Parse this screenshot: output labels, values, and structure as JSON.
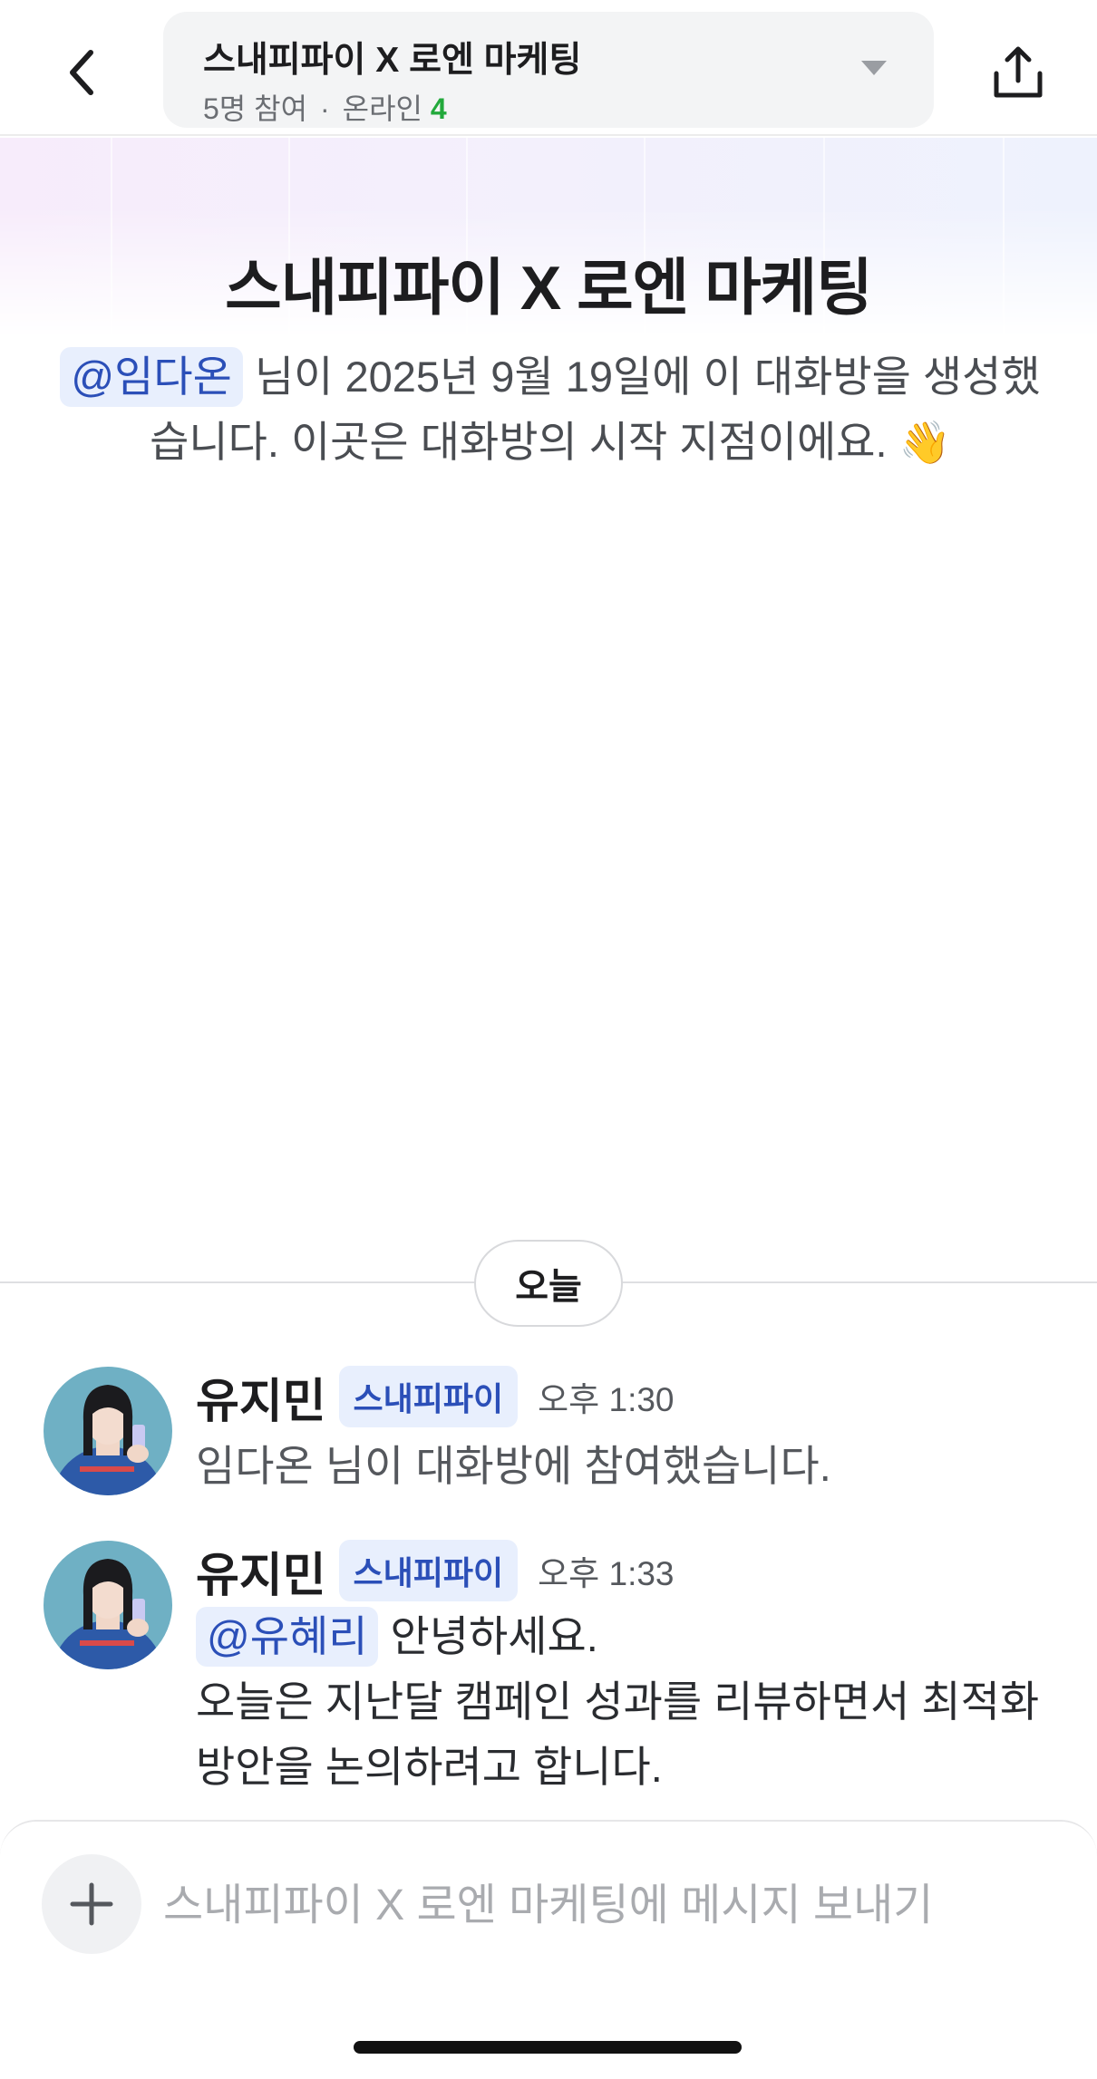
{
  "header": {
    "channel_title": "스내피파이 X 로엔 마케팅",
    "members": "5명 참여",
    "separator": "·",
    "online_label": "온라인",
    "online_count": "4"
  },
  "intro": {
    "title": "스내피파이 X 로엔 마케팅",
    "creator_mention": "@임다온",
    "created_text": " 님이 2025년 9월 19일에 이 대화방을 생성했습니다. 이곳은 대화방의 시작 지점이에요. ",
    "emoji": "👋"
  },
  "date_divider": "오늘",
  "messages": [
    {
      "sender": "유지민",
      "org": "스내피파이",
      "time": "오후 1:30",
      "text": "임다온 님이 대화방에 참여했습니다."
    },
    {
      "sender": "유지민",
      "org": "스내피파이",
      "time": "오후 1:33",
      "mention": "@유혜리",
      "line1": " 안녕하세요.",
      "line2": "오늘은 지난달 캠페인 성과를 리뷰하면서 최적화 방안을 논의하려고 합니다."
    }
  ],
  "composer": {
    "placeholder": "스내피파이 X 로엔 마케팅에 메시지 보내기",
    "value": ""
  },
  "colors": {
    "accent_blue": "#2b4fb8",
    "mention_bg": "#e8effd",
    "online_green": "#22a93b"
  },
  "icons": {
    "back": "chevron-left-icon",
    "dropdown": "caret-down-icon",
    "share": "share-icon",
    "add": "plus-icon"
  }
}
